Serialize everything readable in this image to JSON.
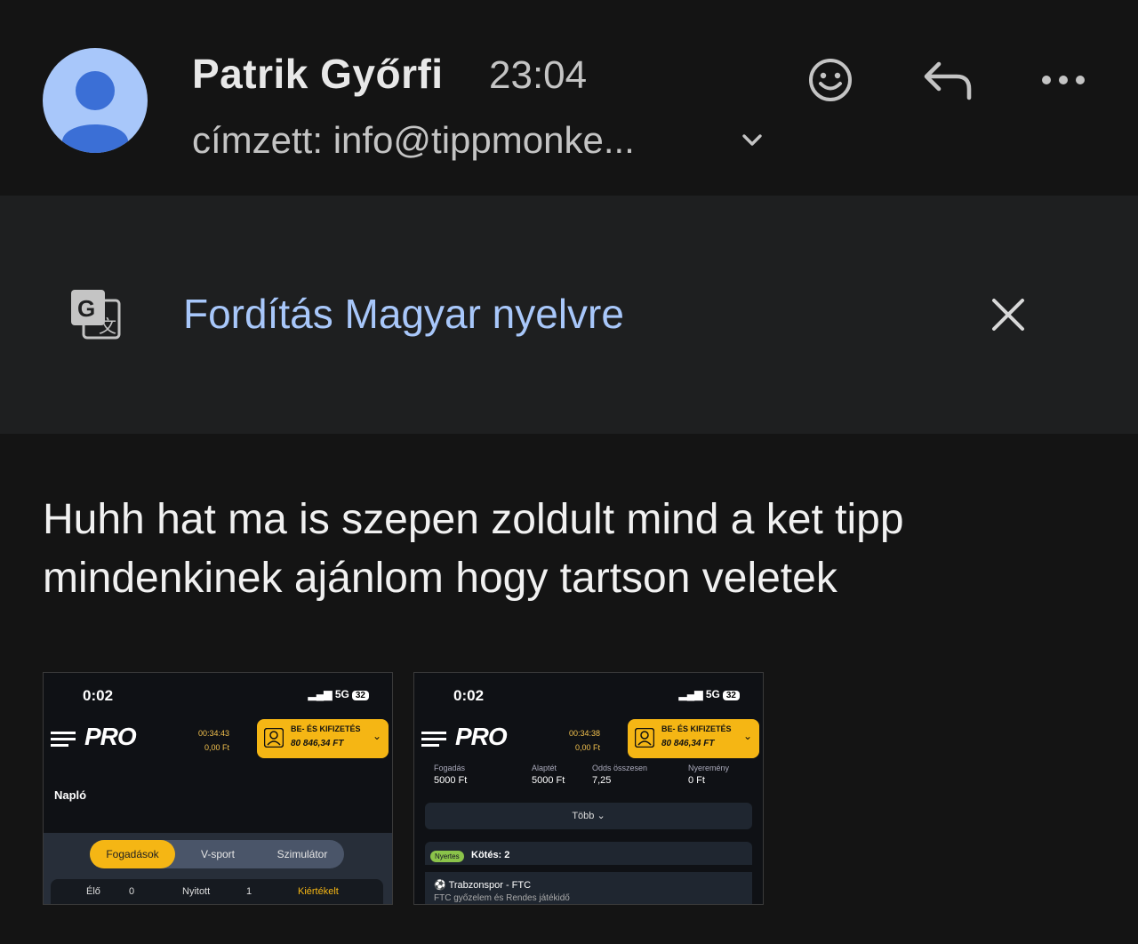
{
  "header": {
    "sender_name": "Patrik Győrfi",
    "time": "23:04",
    "recipient": "címzett: info@tippmonke...",
    "icons": [
      "emoji-icon",
      "reply-icon",
      "more-icon",
      "chevron-down-icon"
    ]
  },
  "translate_banner": {
    "link_text": "Fordítás Magyar nyelvre",
    "icons": [
      "google-translate-icon",
      "close-icon"
    ]
  },
  "message": {
    "line1": "Huhh hat ma is szepen zoldult mind a ket tipp",
    "line2": "mindenkinek ajánlom hogy tartson veletek"
  },
  "attachments": [
    {
      "clock": "0:02",
      "signal": "5G",
      "battery": "32",
      "logo": "PRO",
      "timer_top": "00:34:43",
      "timer_bottom": "0,00 Ft",
      "deposit_line1": "BE- ÉS KIFIZETÉS",
      "deposit_line2": "80 846,34 FT",
      "section_title": "Napló",
      "tabs": [
        "Fogadások",
        "V-sport",
        "Szimulátor"
      ],
      "active_tab": "Fogadások",
      "counts": [
        {
          "label": "Élő",
          "value": "0"
        },
        {
          "label": "Nyitott",
          "value": "1"
        },
        {
          "label": "Kiértékelt",
          "value": ""
        }
      ]
    },
    {
      "clock": "0:02",
      "signal": "5G",
      "battery": "32",
      "logo": "PRO",
      "timer_top": "00:34:38",
      "timer_bottom": "0,00 Ft",
      "deposit_line1": "BE- ÉS KIFIZETÉS",
      "deposit_line2": "80 846,34 FT",
      "stats": [
        {
          "label": "Fogadás",
          "value": "5000 Ft"
        },
        {
          "label": "Alaptét",
          "value": "5000 Ft"
        },
        {
          "label": "Odds összesen",
          "value": "7,25"
        },
        {
          "label": "Nyeremény",
          "value": "0 Ft"
        }
      ],
      "more_label": "Több",
      "badge": "Nyertes",
      "kotes": "Kötés: 2",
      "match": "Trabzonspor - FTC",
      "match_sub": "FTC győzelem és Rendes játékidő"
    }
  ],
  "colors": {
    "background": "#141414",
    "banner": "#1e1f20",
    "link": "#a8c7fa",
    "avatar": "#a8c7fa",
    "accent": "#f5b614"
  }
}
